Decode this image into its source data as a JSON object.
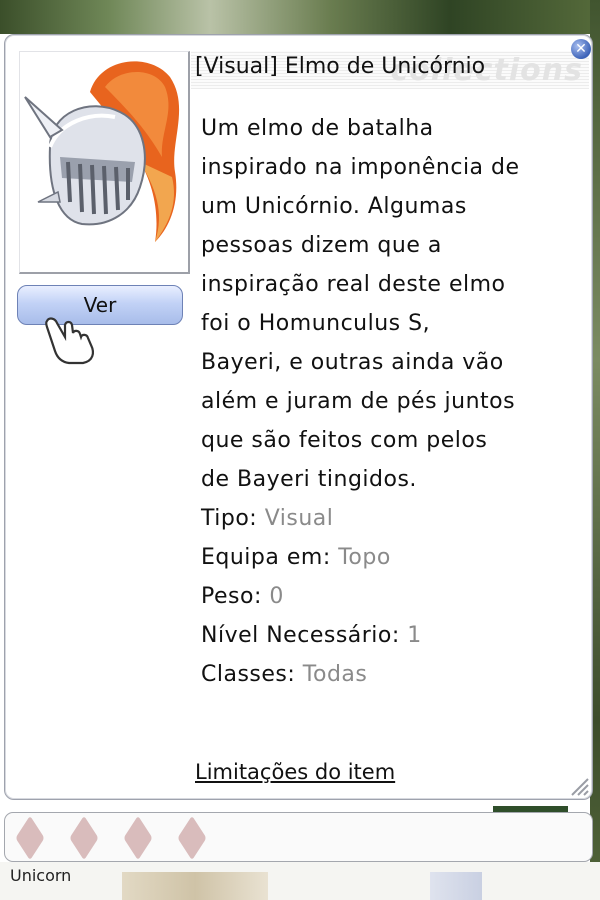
{
  "item": {
    "title": "[Visual] Elmo de Unicórnio",
    "image_icon": "unicorn-helm-icon",
    "view_button_label": "Ver",
    "description_lines": [
      "Um elmo de batalha",
      "inspirado na imponência de",
      "um Unicórnio. Algumas",
      "pessoas dizem que a",
      "inspiração real deste elmo",
      "foi o Homunculus S,",
      "Bayeri, e outras ainda vão",
      "além e juram de pés juntos",
      "que são feitos com pelos",
      "de Bayeri tingidos."
    ],
    "properties": [
      {
        "label": "Tipo: ",
        "value": "Visual"
      },
      {
        "label": "Equipa em: ",
        "value": "Topo"
      },
      {
        "label": "Peso: ",
        "value": "0"
      },
      {
        "label": "Nível Necessário: ",
        "value": "1"
      },
      {
        "label": "Classes: ",
        "value": "Todas"
      }
    ],
    "limits_link": "Limitações do item"
  },
  "window": {
    "close_icon": "close-icon",
    "watermark": "collections"
  },
  "background": {
    "bottom_text": "Unicorn"
  },
  "slots": {
    "count": 4,
    "color": "#d9bcbc"
  },
  "colors": {
    "title_text": "#111111",
    "value_text": "#8a8a8a",
    "button_top": "#e9efff",
    "button_bottom": "#a8bdea"
  }
}
